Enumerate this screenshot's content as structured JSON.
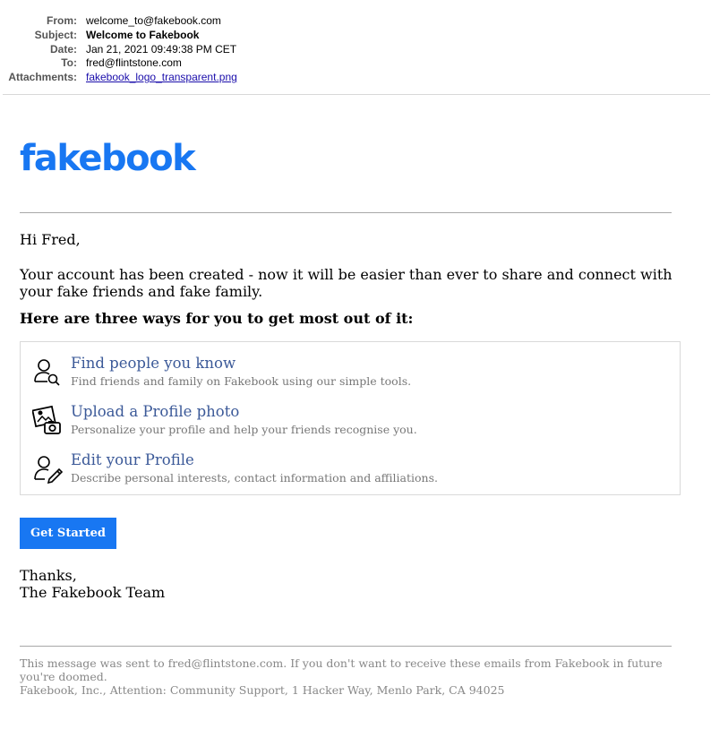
{
  "header": {
    "from_label": "From:",
    "from": "welcome_to@fakebook.com",
    "subject_label": "Subject:",
    "subject": "Welcome to Fakebook",
    "date_label": "Date:",
    "date": "Jan 21, 2021 09:49:38 PM CET",
    "to_label": "To:",
    "to": "fred@flintstone.com",
    "attachments_label": "Attachments:",
    "attachment": "fakebook_logo_transparent.png"
  },
  "email": {
    "logo_text": "fakebook",
    "greeting": "Hi Fred,",
    "intro": "Your account has been created - now it will be easier than ever to share and connect with your fake friends and fake family.",
    "ways_title": "Here are three ways for you to get most out of it:",
    "items": [
      {
        "icon": "find-people-icon",
        "title": "Find people you know",
        "desc": "Find friends and family on Fakebook using our simple tools."
      },
      {
        "icon": "profile-photo-icon",
        "title": "Upload a Profile photo",
        "desc": "Personalize your profile and help your friends recognise you."
      },
      {
        "icon": "edit-profile-icon",
        "title": "Edit your Profile",
        "desc": "Describe personal interests, contact information and affiliations."
      }
    ],
    "cta": "Get Started",
    "thanks": "Thanks,",
    "signature": "The Fakebook Team",
    "footer_note": "This message was sent to fred@flintstone.com. If you don't want to receive these emails from Fakebook in future you're doomed.",
    "footer_address": "Fakebook, Inc., Attention: Community Support, 1 Hacker Way, Menlo Park, CA 94025"
  },
  "colors": {
    "brand": "#1877f2",
    "link_title": "#3b5998",
    "muted": "#777777"
  }
}
